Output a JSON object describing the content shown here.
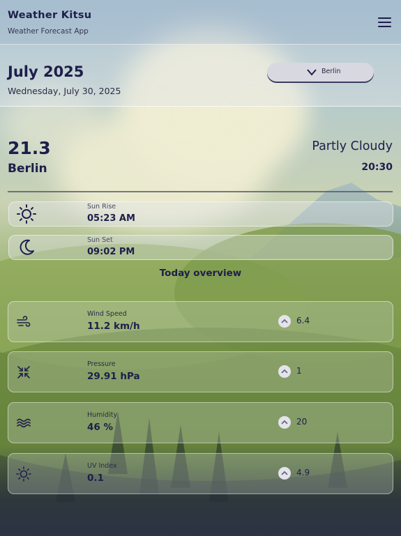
{
  "app": {
    "title": "Weather Kitsu",
    "subtitle": "Weather Forecast App"
  },
  "date": {
    "month": "July 2025",
    "full": "Wednesday, July 30, 2025"
  },
  "city_select": {
    "value": "Berlin"
  },
  "current": {
    "temperature": "21.3",
    "city": "Berlin",
    "condition": "Partly Cloudy",
    "time": "20:30"
  },
  "sun": {
    "sunrise": {
      "label": "Sun Rise",
      "value": "05:23 AM",
      "icon": "sun-icon"
    },
    "sunset": {
      "label": "Sun Set",
      "value": "09:02 PM",
      "icon": "moon-icon"
    }
  },
  "overview": {
    "title": "Today overview",
    "metrics": [
      {
        "label": "Wind Speed",
        "value": "11.2 km/h",
        "delta": "6.4",
        "icon": "wind-icon"
      },
      {
        "label": "Pressure",
        "value": "29.91 hPa",
        "delta": "1",
        "icon": "compress-icon"
      },
      {
        "label": "Humidity",
        "value": "46 %",
        "delta": "20",
        "icon": "waves-icon"
      },
      {
        "label": "UV Index",
        "value": "0.1",
        "delta": "4.9",
        "icon": "sun-icon"
      }
    ]
  },
  "colors": {
    "text": "#1e1e4a",
    "accent": "#d8d8e1"
  }
}
